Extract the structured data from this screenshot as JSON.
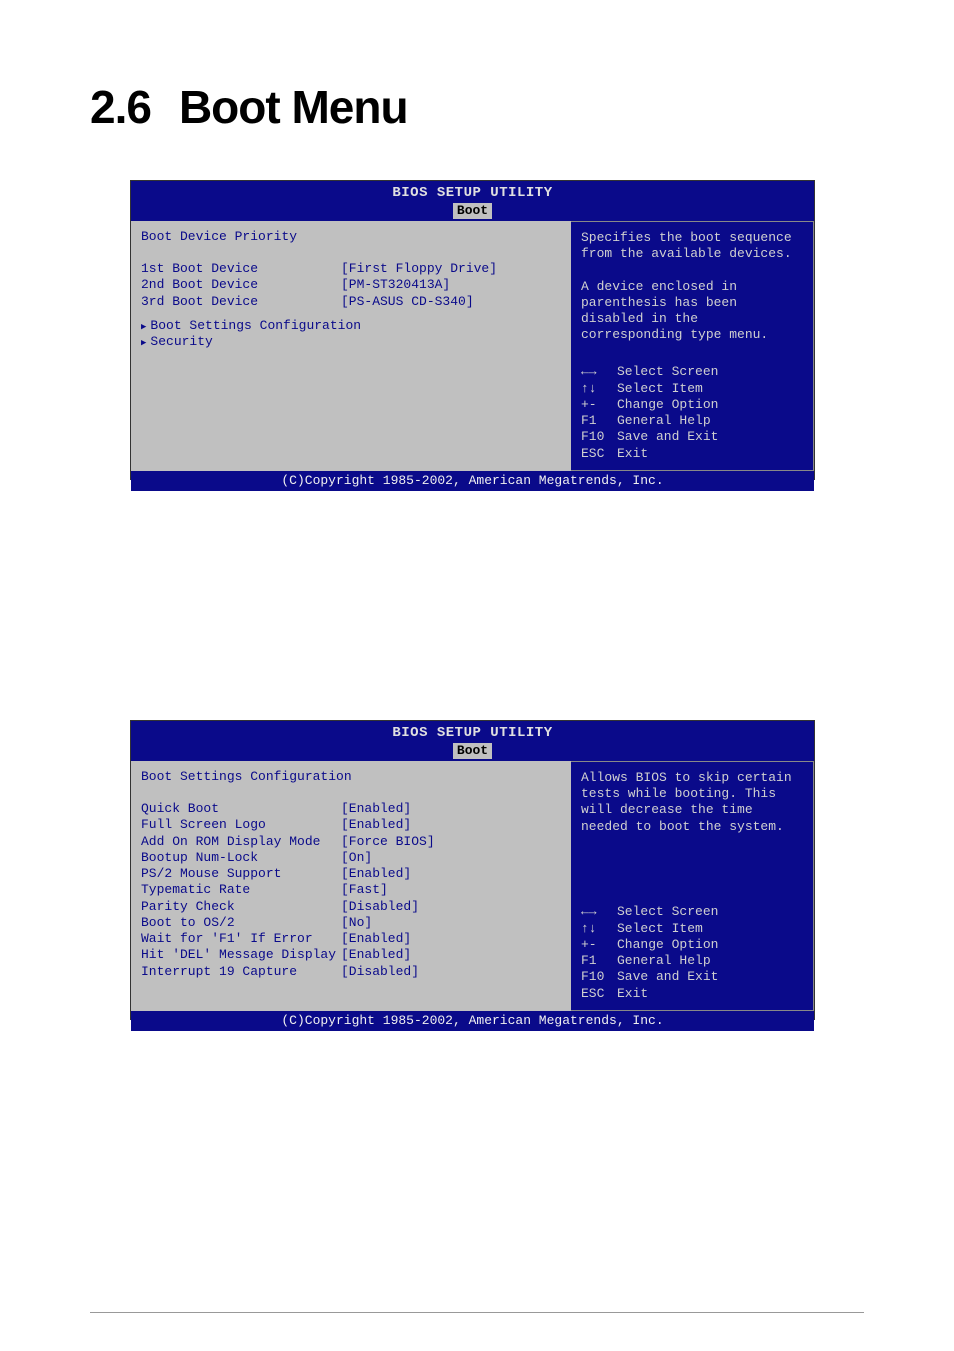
{
  "heading": {
    "number": "2.6",
    "text": "Boot Menu"
  },
  "bios1": {
    "title": "BIOS SETUP UTILITY",
    "tab": "Boot",
    "section_title": "Boot Device Priority",
    "items": [
      {
        "label": "1st Boot Device",
        "value": "[First Floppy Drive]"
      },
      {
        "label": "2nd Boot Device",
        "value": "[PM-ST320413A]"
      },
      {
        "label": "3rd Boot Device",
        "value": "[PS-ASUS CD-S340]"
      }
    ],
    "submenus": [
      "Boot Settings Configuration",
      "Security"
    ],
    "help": "Specifies the boot sequence from the available devices.\n\nA device enclosed in parenthesis has been disabled in the corresponding type menu.",
    "nav": [
      {
        "key": "←→",
        "desc": "Select Screen"
      },
      {
        "key": "↑↓",
        "desc": "Select Item"
      },
      {
        "key": "+-",
        "desc": "Change Option"
      },
      {
        "key": "F1",
        "desc": "General Help"
      },
      {
        "key": "F10",
        "desc": "Save and Exit"
      },
      {
        "key": "ESC",
        "desc": "Exit"
      }
    ],
    "footer": "(C)Copyright 1985-2002, American Megatrends, Inc."
  },
  "bios2": {
    "title": "BIOS SETUP UTILITY",
    "tab": "Boot",
    "section_title": "Boot Settings Configuration",
    "items": [
      {
        "label": "Quick Boot",
        "value": "[Enabled]"
      },
      {
        "label": "Full Screen Logo",
        "value": "[Enabled]"
      },
      {
        "label": "Add On ROM Display Mode",
        "value": "[Force BIOS]"
      },
      {
        "label": "Bootup Num-Lock",
        "value": "[On]"
      },
      {
        "label": "PS/2 Mouse Support",
        "value": "[Enabled]"
      },
      {
        "label": "Typematic Rate",
        "value": "[Fast]"
      },
      {
        "label": "Parity Check",
        "value": "[Disabled]"
      },
      {
        "label": "Boot to OS/2",
        "value": "[No]"
      },
      {
        "label": "Wait for 'F1' If Error",
        "value": "[Enabled]"
      },
      {
        "label": "Hit 'DEL' Message Display",
        "value": "[Enabled]"
      },
      {
        "label": "Interrupt 19 Capture",
        "value": "[Disabled]"
      }
    ],
    "help": "Allows BIOS to skip certain tests while booting. This will decrease the time needed to boot the system.",
    "nav": [
      {
        "key": "←→",
        "desc": "Select Screen"
      },
      {
        "key": "↑↓",
        "desc": "Select Item"
      },
      {
        "key": "+-",
        "desc": "Change Option"
      },
      {
        "key": "F1",
        "desc": "General Help"
      },
      {
        "key": "F10",
        "desc": "Save and Exit"
      },
      {
        "key": "ESC",
        "desc": "Exit"
      }
    ],
    "footer": "(C)Copyright 1985-2002, American Megatrends, Inc."
  }
}
